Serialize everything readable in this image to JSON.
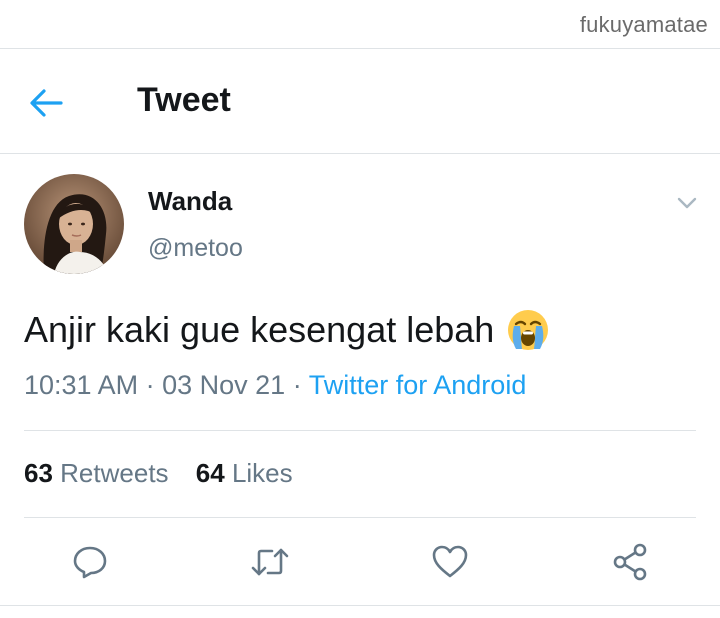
{
  "watermark": "fukuyamatae",
  "header": {
    "title": "Tweet",
    "back_icon": "arrow-left-icon"
  },
  "tweet": {
    "author_name": "Wanda",
    "author_handle": "@metoo",
    "text": "Anjir kaki gue kesengat lebah",
    "emoji": "loudly-crying-face-emoji",
    "time": "10:31 AM",
    "date": "03 Nov 21",
    "separator": "·",
    "source": "Twitter for Android"
  },
  "stats": {
    "retweets_count": "63",
    "retweets_label": "Retweets",
    "likes_count": "64",
    "likes_label": "Likes"
  },
  "actions": [
    "reply-icon",
    "retweet-icon",
    "like-icon",
    "share-icon"
  ],
  "colors": {
    "accent": "#1da1f2",
    "text": "#14171a",
    "secondary": "#657786",
    "divider": "#dfe3e6"
  }
}
